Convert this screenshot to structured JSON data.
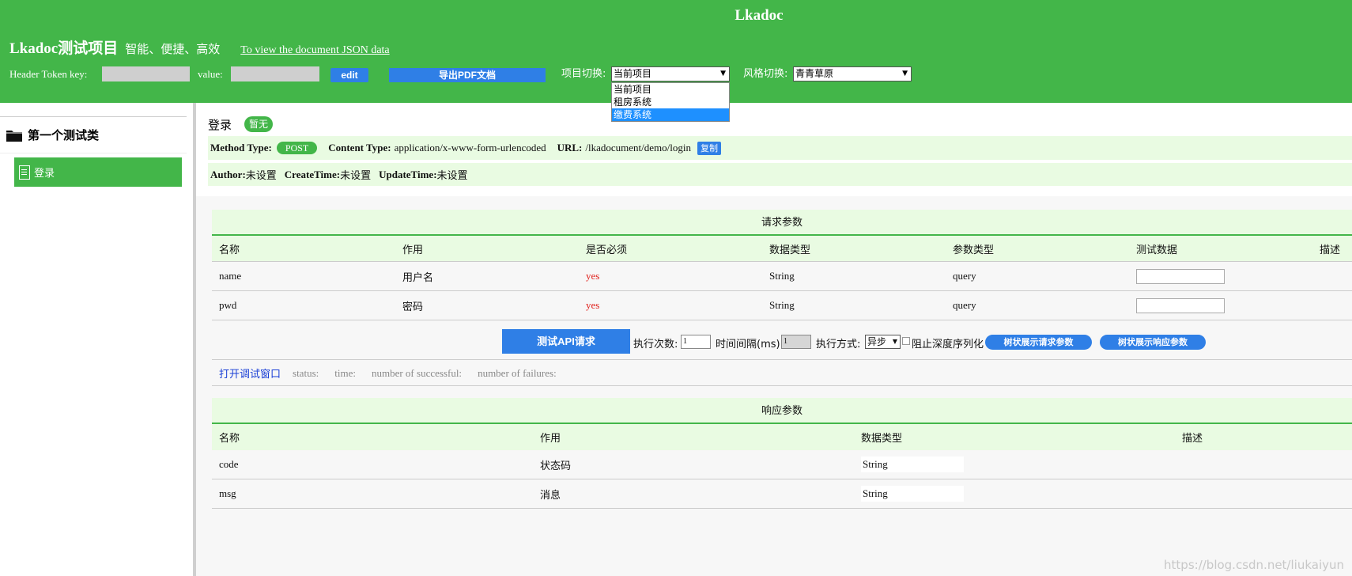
{
  "header": {
    "app_title": "Lkadoc",
    "project_name": "Lkadoc测试项目",
    "slogan": "智能、便捷、高效",
    "json_link": "To view the document JSON data",
    "token_label": "Header Token",
    "key_label": "key:",
    "value_label": "value:",
    "edit_button": "edit",
    "export_pdf_button": "导出PDF文档",
    "project_switch_label": "项目切换:",
    "project_selected": "当前项目",
    "project_options": [
      "当前项目",
      "租房系统",
      "缴费系统"
    ],
    "project_highlighted_index": 2,
    "style_switch_label": "风格切换:",
    "style_selected": "青青草原",
    "background_color": "#43b649"
  },
  "sidebar": {
    "category": "第一个测试类",
    "items": [
      {
        "label": "登录",
        "active": true
      }
    ]
  },
  "api": {
    "title": "登录",
    "badge": "暂无",
    "method_label": "Method Type:",
    "method": "POST",
    "content_type_label": "Content Type:",
    "content_type": "application/x-www-form-urlencoded",
    "url_label": "URL:",
    "url": "/lkadocument/demo/login",
    "copy_button": "复制",
    "author_label": "Author:",
    "author": "未设置",
    "create_label": "CreateTime:",
    "create_time": "未设置",
    "update_label": "UpdateTime:",
    "update_time": "未设置"
  },
  "request_params": {
    "title": "请求参数",
    "columns": [
      "名称",
      "作用",
      "是否必须",
      "数据类型",
      "参数类型",
      "测试数据",
      "描述"
    ],
    "rows": [
      {
        "name": "name",
        "purpose": "用户名",
        "required": "yes",
        "type": "String",
        "param_type": "query",
        "test_value": ""
      },
      {
        "name": "pwd",
        "purpose": "密码",
        "required": "yes",
        "type": "String",
        "param_type": "query",
        "test_value": ""
      }
    ]
  },
  "actions": {
    "test_button": "测试API请求",
    "exec_count_label": "执行次数:",
    "exec_count": "1",
    "interval_label": "时间间隔(ms):",
    "interval": "1",
    "exec_mode_label": "执行方式:",
    "exec_mode": "异步",
    "deep_serialize_label": "阻止深度序列化",
    "tree_request_button": "树状展示请求参数",
    "tree_response_button": "树状展示响应参数"
  },
  "status": {
    "debug_link": "打开调试窗口",
    "status_label": "status:",
    "time_label": "time:",
    "success_label": "number of successful:",
    "failure_label": "number of failures:"
  },
  "response_params": {
    "title": "响应参数",
    "columns": [
      "名称",
      "作用",
      "数据类型",
      "描述"
    ],
    "rows": [
      {
        "name": "code",
        "purpose": "状态码",
        "type": "String"
      },
      {
        "name": "msg",
        "purpose": "消息",
        "type": "String"
      }
    ]
  },
  "watermark": "https://blog.csdn.net/liukaiyun"
}
